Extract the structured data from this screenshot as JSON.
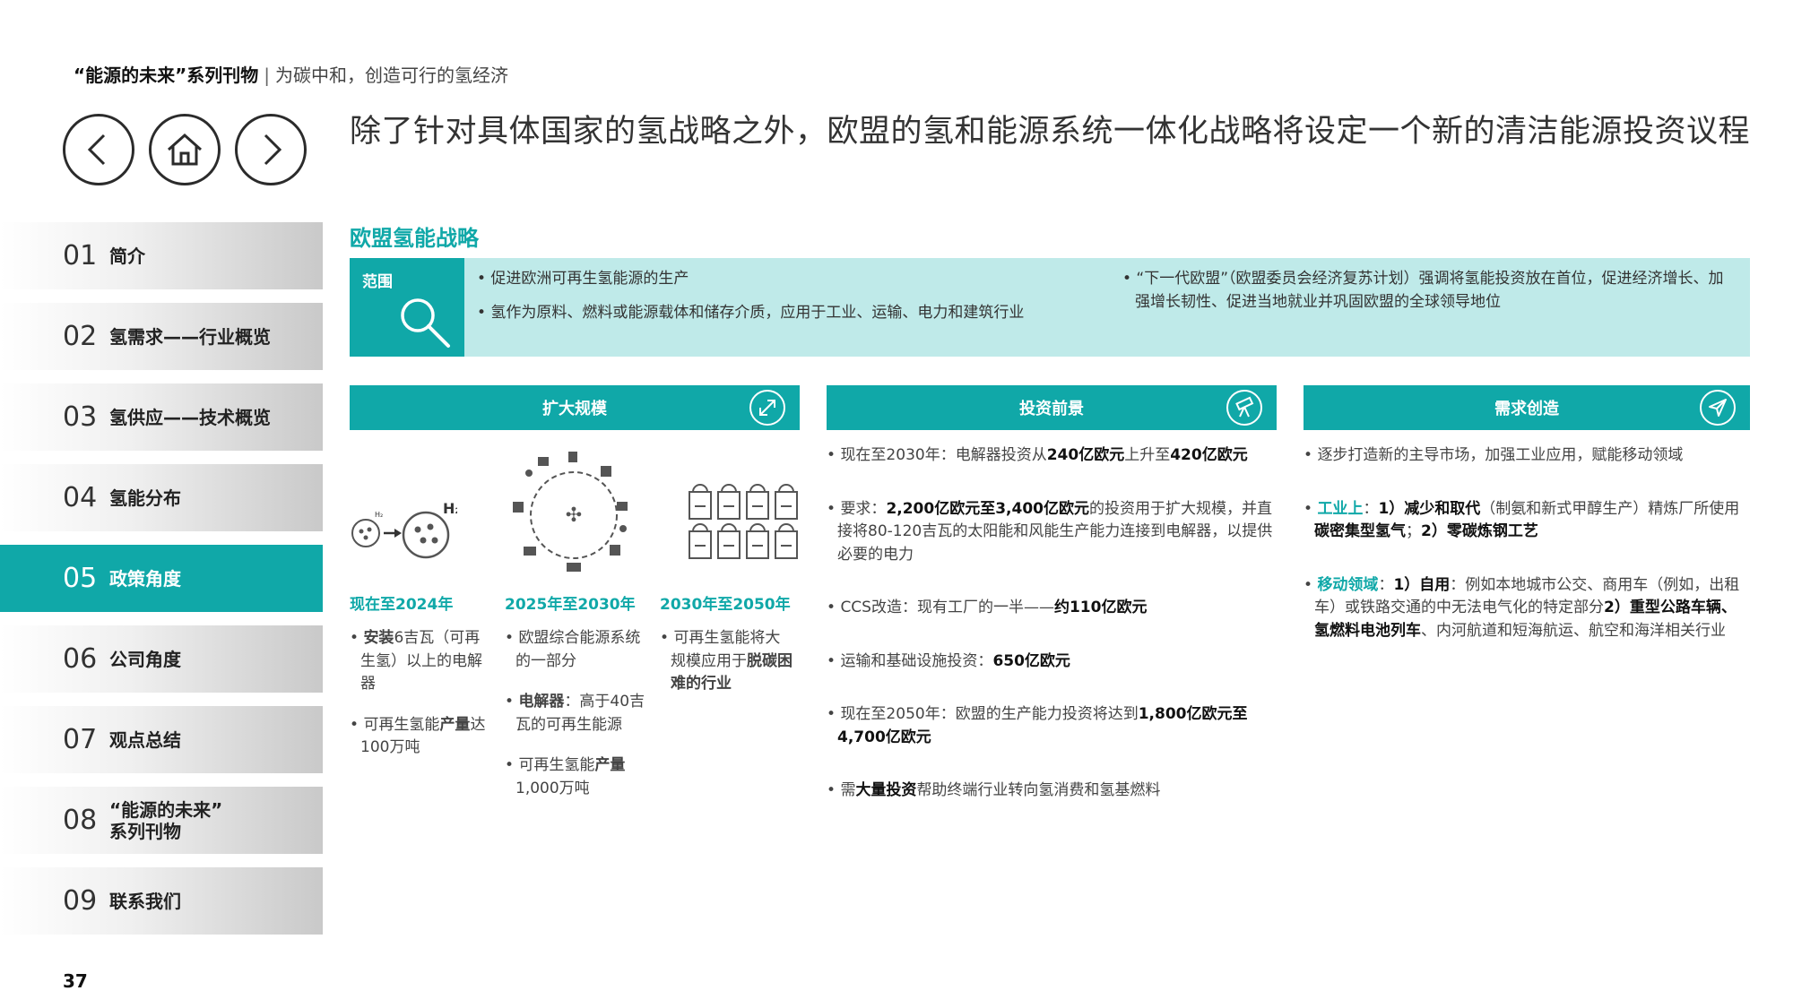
{
  "header": {
    "series_title": "“能源的未来”系列刊物",
    "separator": "|",
    "subtitle": "为碳中和，创造可行的氢经济"
  },
  "nav": {
    "back_icon": "chevron-left-icon",
    "home_icon": "home-icon",
    "next_icon": "chevron-right-icon"
  },
  "page_title": "除了针对具体国家的氢战略之外，欧盟的氢和能源系统一体化战略将设定一个新的清洁能源投资议程",
  "sidebar": {
    "items": [
      {
        "num": "01",
        "label": "简介"
      },
      {
        "num": "02",
        "label": "氢需求——行业概览"
      },
      {
        "num": "03",
        "label": "氢供应——技术概览"
      },
      {
        "num": "04",
        "label": "氢能分布"
      },
      {
        "num": "05",
        "label": "政策角度"
      },
      {
        "num": "06",
        "label": "公司角度"
      },
      {
        "num": "07",
        "label": "观点总结"
      },
      {
        "num": "08",
        "label": "“能源的未来”\n系列刊物"
      },
      {
        "num": "09",
        "label": "联系我们"
      }
    ],
    "active_index": 4
  },
  "section_title": "欧盟氢能战略",
  "scope": {
    "label": "范围",
    "icon": "magnifier-icon",
    "left_bullets": [
      "• 促进欧洲可再生氢能源的生产",
      "• 氢作为原料、燃料或能源载体和储存介质，应用于工业、运输、电力和建筑行业"
    ],
    "right_bullets": [
      "• “下一代欧盟”（欧盟委员会经济复苏计划）强调将氢能投资放在首位，促进经济增长、加强增长韧性、促进当地就业并巩固欧盟的全球领导地位"
    ]
  },
  "columns": {
    "scale_up": {
      "title": "扩大规模",
      "icon": "expand-arrows-icon",
      "h2_label": "H₂",
      "h2_small_label": "H₂",
      "phases": [
        {
          "label": "现在至2024年",
          "bullets": [
            {
              "parts": [
                [
                  "b",
                  "安装"
                ],
                [
                  "n",
                  "6吉瓦（可再生氢）以上的电解器"
                ]
              ]
            },
            {
              "parts": [
                [
                  "n",
                  "可再生氢能"
                ],
                [
                  "b",
                  "产量"
                ],
                [
                  "n",
                  "达100万吨"
                ]
              ]
            }
          ]
        },
        {
          "label": "2025年至2030年",
          "bullets": [
            {
              "parts": [
                [
                  "n",
                  "欧盟综合能源系统的一部分"
                ]
              ]
            },
            {
              "parts": [
                [
                  "b",
                  "电解器"
                ],
                [
                  "n",
                  "：高于40吉瓦的可再生能源"
                ]
              ]
            },
            {
              "parts": [
                [
                  "n",
                  "可再生氢能"
                ],
                [
                  "b",
                  "产量"
                ],
                [
                  "n",
                  "1,000万吨"
                ]
              ]
            }
          ]
        },
        {
          "label": "2030年至2050年",
          "bullets": [
            {
              "parts": [
                [
                  "n",
                  "可再生氢能将大规模应用于"
                ],
                [
                  "b",
                  "脱碳困难的行业"
                ]
              ]
            }
          ]
        }
      ]
    },
    "investment": {
      "title": "投资前景",
      "icon": "telescope-icon",
      "bullets": [
        {
          "parts": [
            [
              "n",
              "现在至2030年：电解器投资从"
            ],
            [
              "b",
              "240亿欧元"
            ],
            [
              "n",
              "上升至"
            ],
            [
              "b",
              "420亿欧元"
            ]
          ]
        },
        {
          "parts": [
            [
              "n",
              "要求："
            ],
            [
              "b",
              "2,200亿欧元至3,400亿欧元"
            ],
            [
              "n",
              "的投资用于扩大规模，并直接将80-120吉瓦的太阳能和风能生产能力连接到电解器，以提供必要的电力"
            ]
          ]
        },
        {
          "parts": [
            [
              "n",
              "CCS改造：现有工厂的一半——"
            ],
            [
              "b",
              "约110亿欧元"
            ]
          ]
        },
        {
          "parts": [
            [
              "n",
              "运输和基础设施投资："
            ],
            [
              "b",
              "650亿欧元"
            ]
          ]
        },
        {
          "parts": [
            [
              "n",
              "现在至2050年：欧盟的生产能力投资将达到"
            ],
            [
              "b",
              "1,800亿欧元至4,700亿欧元"
            ]
          ]
        },
        {
          "parts": [
            [
              "n",
              "需"
            ],
            [
              "b",
              "大量投资"
            ],
            [
              "n",
              "帮助终端行业转向氢消费和氢基燃料"
            ]
          ]
        }
      ]
    },
    "demand": {
      "title": "需求创造",
      "icon": "paper-plane-icon",
      "bullets": [
        {
          "parts": [
            [
              "n",
              "逐步打造新的主导市场，加强工业应用，赋能移动领域"
            ]
          ]
        },
        {
          "parts": [
            [
              "t",
              "工业上"
            ],
            [
              "n",
              "："
            ],
            [
              "b",
              "1）减少和取代"
            ],
            [
              "n",
              "（制氨和新式甲醇生产）精炼厂所使用"
            ],
            [
              "b",
              "碳密集型氢气"
            ],
            [
              "n",
              "；"
            ],
            [
              "b",
              "2）零碳炼钢工艺"
            ]
          ]
        },
        {
          "parts": [
            [
              "t",
              "移动领域"
            ],
            [
              "n",
              "："
            ],
            [
              "b",
              "1）自用"
            ],
            [
              "n",
              "：例如本地城市公交、商用车（例如，出租车）或铁路交通的中无法电气化的特定部分"
            ],
            [
              "b",
              "2）重型公路车辆、氢燃料电池列车"
            ],
            [
              "n",
              "、内河航道和短海航运、航空和海洋相关行业"
            ]
          ]
        }
      ]
    }
  },
  "page_number": "37",
  "colors": {
    "accent": "#10a8a8",
    "accent_light": "#bfeae9",
    "text": "#333333"
  }
}
